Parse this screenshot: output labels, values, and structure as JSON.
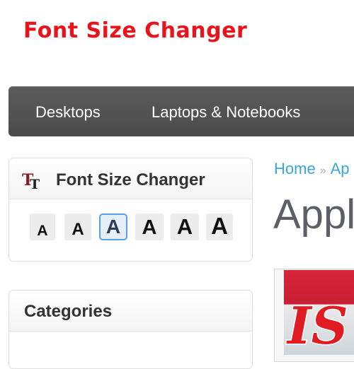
{
  "banner": {
    "title": "Font Size Changer"
  },
  "nav": {
    "items": [
      "Desktops",
      "Laptops & Notebooks"
    ]
  },
  "font_size_box": {
    "title": "Font Size Changer",
    "icon": "font-size-tt-icon",
    "buttons": [
      {
        "label": "A",
        "selected": false
      },
      {
        "label": "A",
        "selected": false
      },
      {
        "label": "A",
        "selected": true
      },
      {
        "label": "A",
        "selected": false
      },
      {
        "label": "A",
        "selected": false
      },
      {
        "label": "A",
        "selected": false
      }
    ]
  },
  "categories_box": {
    "title": "Categories"
  },
  "breadcrumb": {
    "home": "Home",
    "separator": "»",
    "current": "Ap"
  },
  "page": {
    "title": "Appl"
  },
  "colors": {
    "banner_red": "#e8141b",
    "navbar": "#4f4f4f",
    "link_blue": "#38a7d8",
    "selected_border": "#5aa0e6"
  }
}
